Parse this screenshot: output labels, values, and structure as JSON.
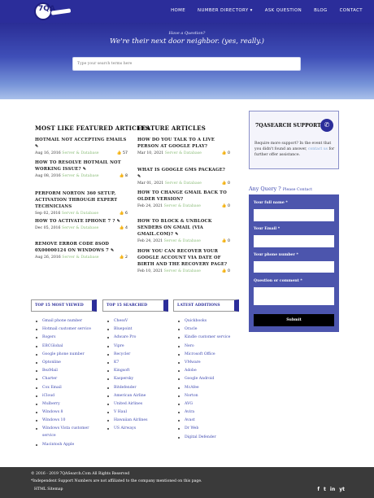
{
  "nav": {
    "logo_text": "7QA",
    "links": [
      "HOME",
      "NUMBER DIRECTORY ▾",
      "ASK QUESTION",
      "BLOG",
      "CONTACT"
    ]
  },
  "hero": {
    "small": "Have a Question?",
    "title": "We're their next door neighbor. (yes, really.)",
    "search_placeholder": "Type your search terms here"
  },
  "featured_most": {
    "title": "MOST LIKE FEATURED ARTICLES",
    "articles": [
      {
        "title": "HOTMAIL NOT ACCEPTING EMAILS",
        "date": "Aug 16, 2016",
        "category": "Server & Database",
        "likes": "57"
      },
      {
        "title": "HOW TO RESOLVE HOTMAIL NOT WORKING ISSUE?",
        "date": "Aug 08, 2016",
        "category": "Server & Database",
        "likes": "8"
      },
      {
        "title": "PERFORM NORTON 360 SETUP, ACTIVATION THROUGH EXPERT TECHNICIANS",
        "date": "Sep 02, 2016",
        "category": "Server & Database",
        "likes": "6"
      },
      {
        "title": "HOW TO ACTIVATE IPHONE 7 ?",
        "date": "Dec 05, 2016",
        "category": "Server & Database",
        "likes": "4"
      },
      {
        "title": "REMOVE ERROR CODE 8SOD 0X00000124 ON WINDOWS 7",
        "date": "Aug 26, 2016",
        "category": "Server & Database",
        "likes": "2"
      }
    ]
  },
  "featured": {
    "title": "FEATURE ARTICLES",
    "articles": [
      {
        "title": "HOW DO YOU TALK TO A LIVE PERSON AT GOOGLE PLAY?",
        "date": "Mar 10, 2021",
        "category": "Server & Database",
        "likes": "0"
      },
      {
        "title": "WHAT IS GOOGLE GMS PACKAGE?",
        "date": "Mar 01, 2021",
        "category": "Server & Database",
        "likes": "0"
      },
      {
        "title": "HOW TO CHANGE GMAIL BACK TO OLDER VERSION?",
        "date": "Feb 24, 2021",
        "category": "Server & Database",
        "likes": "0"
      },
      {
        "title": "HOW TO BLOCK & UNBLOCK SENDERS ON GMAIL (VIA GMAIL.COM)?",
        "date": "Feb 24, 2021",
        "category": "Server & Database",
        "likes": "0"
      },
      {
        "title": "HOW YOU CAN RECOVER YOUR GOOGLE ACCOUNT VIA DATE OF BIRTH AND THE RECOVERY PAGE?",
        "date": "Feb 10, 2021",
        "category": "Server & Database",
        "likes": "0"
      }
    ]
  },
  "support": {
    "title": "7QASEARCH SUPPORT",
    "text_before": "Require more support? In the event that you didn't found an answer,",
    "link": "contact us",
    "text_after": "for further offer assistance."
  },
  "query": {
    "title": "Any Query ?",
    "subtitle": "Please Contact",
    "fields": [
      "Your full name *",
      "Your Email *",
      "Your phone number *",
      "Question or comment *"
    ],
    "submit": "Submit"
  },
  "lists": [
    {
      "title": "TOP 15 MOST VIEWED",
      "items": [
        "Gmail phone number",
        "Hotmail customer service",
        "Rogers",
        "EBCGlobal",
        "Google phone number",
        "Optonline",
        "BezMail",
        "Charter",
        "Cox Email",
        "iCloud",
        "Mulberry",
        "Windows 8",
        "Windows 10",
        "Windows Vista customer service",
        "Macintosh Apple"
      ]
    },
    {
      "title": "TOP 15 SEARCHED",
      "items": [
        "ChessV",
        "Bluepoint",
        "Adware Pro",
        "Vipre",
        "Recycler",
        "K7",
        "Kingsoft",
        "Kaspersky",
        "Bitdefender",
        "American Airline",
        "United Airlines",
        "V Haul",
        "Hawaiian Airlines",
        "US Airways"
      ]
    },
    {
      "title": "LATEST ADDITIONS",
      "items": [
        "Quickbooks",
        "Oracle",
        "Kindle customer service",
        "Nero",
        "Microsoft Office",
        "VMware",
        "Adobe",
        "Google Android",
        "McAfee",
        "Norton",
        "AVG",
        "Avira",
        "Avast",
        "Dr Web",
        "Digital Defender"
      ]
    }
  ],
  "footer": {
    "copyright": "© 2016 - 2019   7QASearch.Com All Rights Reserved",
    "disclaimer": "*Independent Support Numbers are not affiliated to the company mentioned on this page.",
    "links": "HTML Sitemap",
    "socials": [
      "f",
      "t",
      "in",
      "yt"
    ]
  }
}
